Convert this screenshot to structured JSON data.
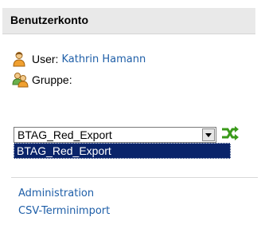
{
  "panel": {
    "title": "Benutzerkonto"
  },
  "user": {
    "label": "User:",
    "name": "Kathrin Hamann",
    "icon": "user-icon"
  },
  "group": {
    "label": "Gruppe:",
    "icon": "group-icon"
  },
  "group_select": {
    "value": "BTAG_Red_Export",
    "options": [
      "BTAG_Red_Export"
    ]
  },
  "switch_button": {
    "icon": "shuffle-icon"
  },
  "links": {
    "administration": "Administration",
    "csv_import": "CSV-Terminimport"
  },
  "colors": {
    "header_bg": "#e9e9e9",
    "link": "#1f5fa8",
    "selection": "#0a246a",
    "icon_green": "#3a9a1a"
  }
}
